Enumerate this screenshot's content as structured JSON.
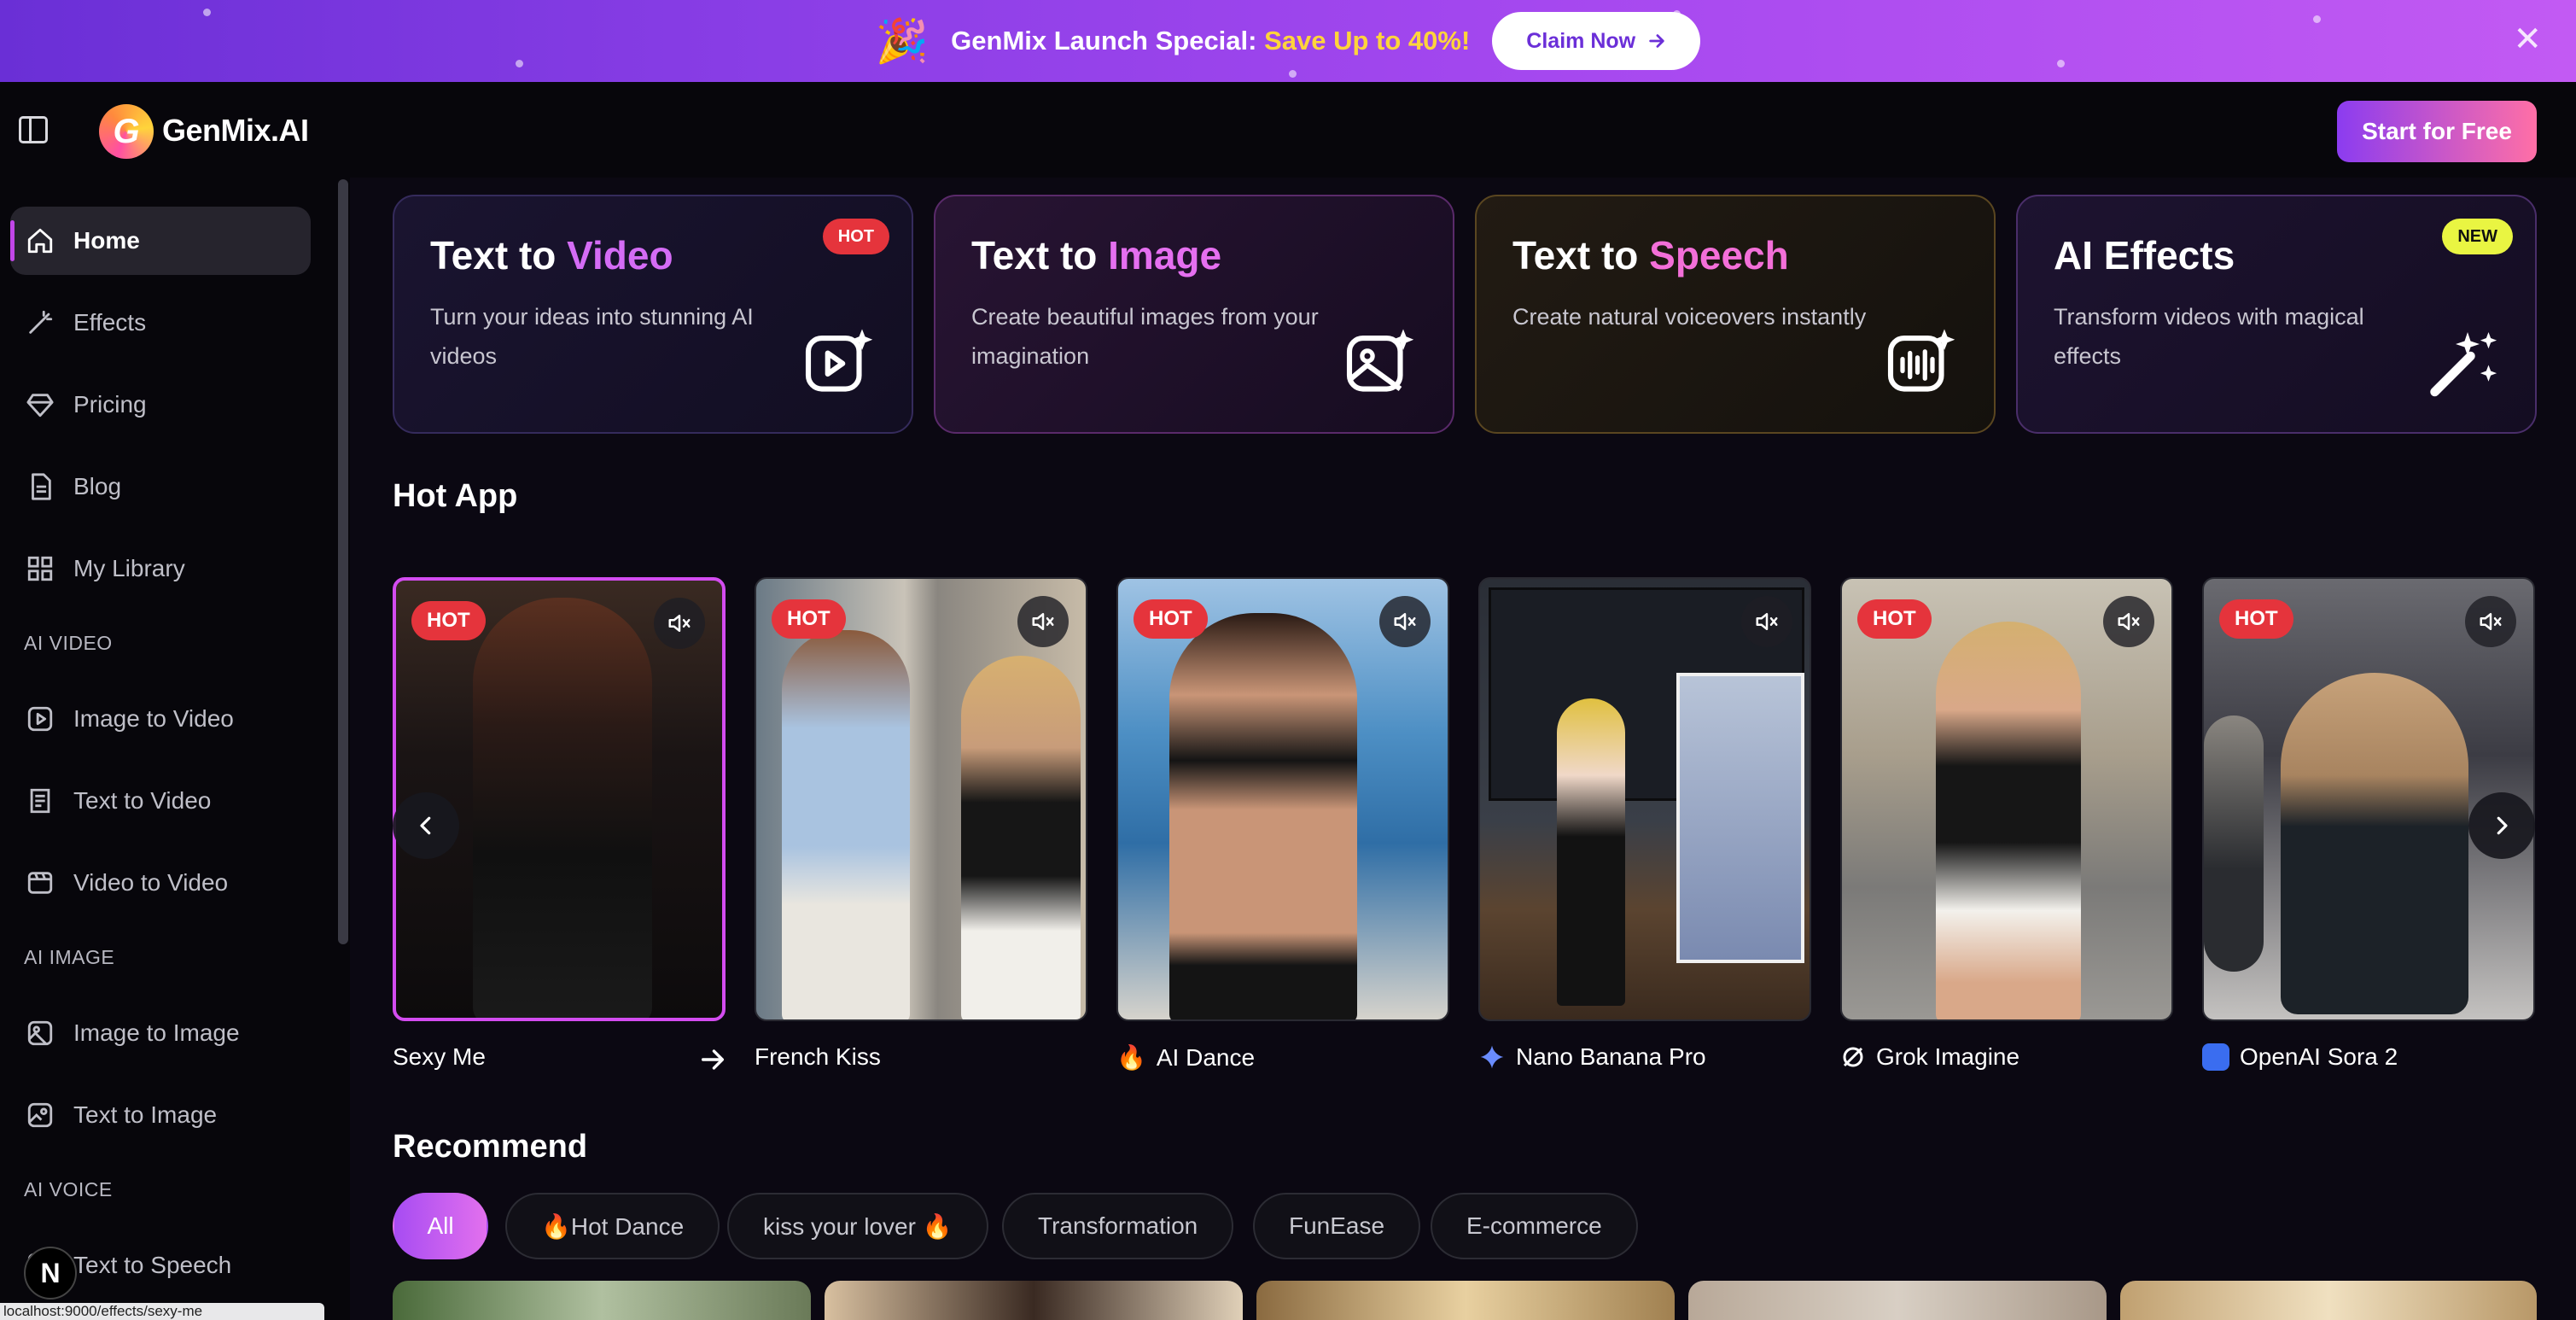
{
  "banner": {
    "message_prefix": "GenMix Launch Special: ",
    "message_highlight": "Save Up to 40%!",
    "cta": "Claim Now"
  },
  "header": {
    "logo_text": "GenMix.AI",
    "cta": "Start for Free"
  },
  "sidebar": {
    "items": [
      {
        "label": "Home"
      },
      {
        "label": "Effects"
      },
      {
        "label": "Pricing"
      },
      {
        "label": "Blog"
      },
      {
        "label": "My Library"
      }
    ],
    "sections": [
      {
        "title": "AI VIDEO",
        "items": [
          "Image to Video",
          "Text to Video",
          "Video to Video"
        ]
      },
      {
        "title": "AI IMAGE",
        "items": [
          "Image to Image",
          "Text to Image"
        ]
      },
      {
        "title": "AI VOICE",
        "items": [
          "Text to Speech"
        ]
      }
    ],
    "badge_letter": "N",
    "status_url": "localhost:9000/effects/sexy-me"
  },
  "features": [
    {
      "title_a": "Text to ",
      "title_b": "Video",
      "desc": "Turn your ideas into stunning AI videos",
      "badge": "HOT",
      "accent": "#d46cf5"
    },
    {
      "title_a": "Text to ",
      "title_b": "Image",
      "desc": "Create beautiful images from your imagination",
      "badge": "",
      "accent": "#e56ff0"
    },
    {
      "title_a": "Text to ",
      "title_b": "Speech",
      "desc": "Create natural voiceovers instantly",
      "badge": "",
      "accent": "#f36fd8"
    },
    {
      "title_a": "AI Effects",
      "title_b": "",
      "desc": "Transform videos with magical effects",
      "badge": "NEW",
      "accent": "#ffffff"
    }
  ],
  "hot_app": {
    "title": "Hot App",
    "apps": [
      {
        "label": "Sexy Me",
        "hot": "HOT"
      },
      {
        "label": "French Kiss",
        "hot": "HOT"
      },
      {
        "label": "AI Dance",
        "hot": "HOT",
        "emoji": "🔥"
      },
      {
        "label": "Nano Banana Pro",
        "hot": ""
      },
      {
        "label": "Grok Imagine",
        "hot": "HOT"
      },
      {
        "label": "OpenAI Sora 2",
        "hot": "HOT"
      }
    ]
  },
  "recommend": {
    "title": "Recommend",
    "chips": [
      "All",
      "🔥Hot Dance",
      "kiss your lover 🔥",
      "Transformation",
      "FunEase",
      "E-commerce"
    ]
  }
}
